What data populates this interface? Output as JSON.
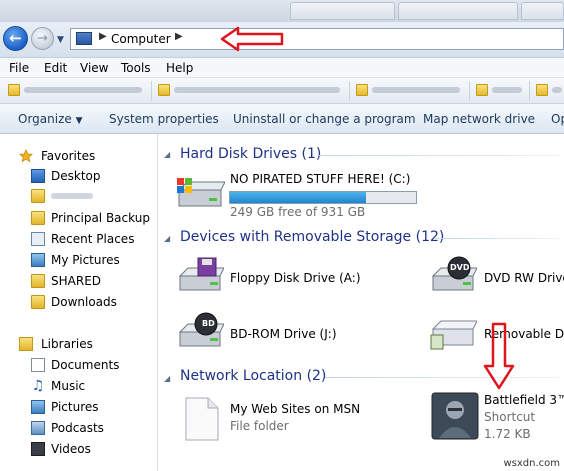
{
  "address": {
    "location": "Computer"
  },
  "menu": [
    "File",
    "Edit",
    "View",
    "Tools",
    "Help"
  ],
  "commands": [
    "Organize",
    "System properties",
    "Uninstall or change a program",
    "Map network drive",
    "Op"
  ],
  "nav": {
    "favorites_label": "Favorites",
    "favorites": [
      "Desktop",
      "",
      "Principal Backup",
      "Recent Places",
      "My Pictures",
      "SHARED",
      "Downloads"
    ],
    "libraries_label": "Libraries",
    "libraries": [
      "Documents",
      "Music",
      "Pictures",
      "Podcasts",
      "Videos"
    ]
  },
  "groups": {
    "hdd_header": "Hard Disk Drives (1)",
    "removable_header": "Devices with Removable Storage (12)",
    "network_header": "Network Location (2)"
  },
  "drives": {
    "c_name": "NO PIRATED STUFF HERE! (C:)",
    "c_free": "249 GB free of 931 GB",
    "c_used_fraction": 0.73,
    "floppy": "Floppy Disk Drive (A:)",
    "dvd": "DVD RW Drive (",
    "bd": "BD-ROM Drive (J:)",
    "removable": "Removable Disk",
    "dvd_label": "DVD",
    "bd_label": "BD"
  },
  "network": {
    "web_name": "My Web Sites on MSN",
    "web_type": "File folder",
    "bf_name": "Battlefield 3™",
    "bf_type": "Shortcut",
    "bf_size": "1.72 KB"
  },
  "watermark": "wsxdn.com",
  "colors": {
    "accent": "#1e3287",
    "annotation_red": "#e0141c",
    "progress_fill": "#1e86cf"
  }
}
